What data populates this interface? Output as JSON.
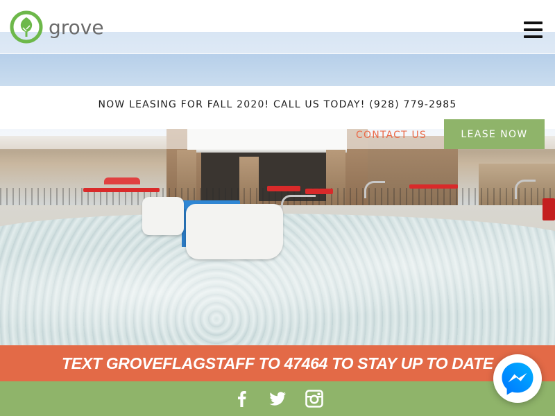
{
  "header": {
    "logo_text": "grove",
    "menu_icon": "hamburger-menu-icon"
  },
  "announcement": {
    "text": "NOW LEASING FOR FALL 2020! CALL US TODAY! (928) 779-2985"
  },
  "actions": {
    "contact_label": "CONTACT US",
    "lease_label": "LEASE NOW"
  },
  "text_banner": {
    "text": "TEXT GROVEFLAGSTAFF TO 47464 TO STAY UP TO DATE"
  },
  "social": {
    "icons": [
      "facebook-icon",
      "twitter-icon",
      "instagram-icon"
    ]
  },
  "messenger": {
    "icon": "messenger-icon"
  },
  "colors": {
    "brand_green": "#8fb46a",
    "accent_orange": "#e36a47",
    "contact_orange": "#ea6a48",
    "logo_green": "#6db84a",
    "messenger_blue": "#0a7cff"
  }
}
